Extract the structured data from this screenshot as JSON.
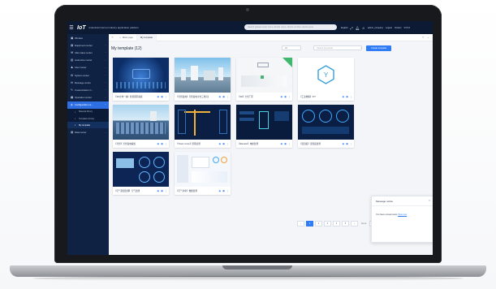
{
  "header": {
    "logo": "IoT",
    "platform_name": "Industrial Internet industry application platform",
    "search_placeholder": "Search (please enter menu, device name, device number, device type)",
    "right_items": [
      "English",
      "admin_company",
      "Logout",
      "Version",
      "V3.5.0"
    ]
  },
  "sidebar": {
    "items": [
      {
        "label": "Window",
        "icon": "window-icon"
      },
      {
        "label": "Equipment center",
        "icon": "device-icon"
      },
      {
        "label": "After sales center",
        "icon": "wrench-icon"
      },
      {
        "label": "Instruction center",
        "icon": "document-icon"
      },
      {
        "label": "User center",
        "icon": "user-icon"
      },
      {
        "label": "System center",
        "icon": "gear-icon"
      },
      {
        "label": "Message center",
        "icon": "bell-icon"
      },
      {
        "label": "Customization C...",
        "icon": "palette-icon"
      },
      {
        "label": "Operation center",
        "icon": "chart-icon"
      },
      {
        "label": "Configuration ce...",
        "icon": "layers-icon"
      }
    ],
    "sub_items": [
      {
        "label": "Material library"
      },
      {
        "label": "Template Library"
      },
      {
        "label": "My template"
      }
    ],
    "trailing_items": [
      {
        "label": "Data center",
        "icon": "database-icon"
      }
    ]
  },
  "tabs": [
    {
      "label": "Main page"
    },
    {
      "label": "My template"
    }
  ],
  "content": {
    "title": "My template (12)",
    "select_value": "All",
    "keyword_placeholder": "Search keywords",
    "create_label": "Create template",
    "badge_label": "Publish"
  },
  "cards": [
    {
      "name": "【3D立体一站】智慧园区看板",
      "theme": "blue-dashboard"
    },
    {
      "name": "【光伏发电】光伏发电平台三维可视化",
      "theme": "city-sky"
    },
    {
      "name": "【3D】全景厂区",
      "theme": "white-lab"
    },
    {
      "name": "【工业物联】IOT",
      "theme": "logo-white"
    },
    {
      "name": "【光伏】光伏发电看板",
      "theme": "solar-field"
    },
    {
      "name": "【Tower crane】塔吊监测",
      "theme": "tower-crane"
    },
    {
      "name": "【Elevator】电梯监测",
      "theme": "elevator"
    },
    {
      "name": "【温湿度】温湿度监测",
      "theme": "gauges"
    },
    {
      "name": "【空气质量监测】空气监测",
      "theme": "blue-gauges"
    },
    {
      "name": "【空气净化】数据监测",
      "theme": "white-dashboard"
    }
  ],
  "pagination": {
    "pages": [
      "1",
      "2",
      "3",
      "4",
      "5"
    ],
    "current": "1",
    "goto_label": "Go to",
    "page_size": "10/page"
  },
  "message": {
    "title": "Message notice",
    "body_prefix": "You have unread news",
    "link": "View now"
  }
}
